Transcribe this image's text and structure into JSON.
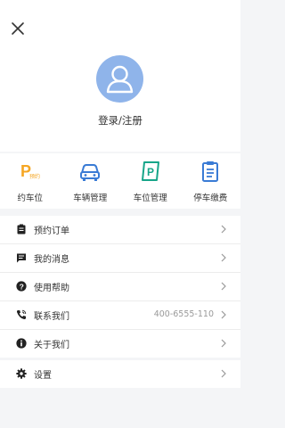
{
  "header": {
    "login_text": "登录/注册"
  },
  "quick_actions": [
    {
      "label": "约车位",
      "icon": "parking-reserve-icon",
      "color": "#f5a623"
    },
    {
      "label": "车辆管理",
      "icon": "car-icon",
      "color": "#3a7bd5"
    },
    {
      "label": "车位管理",
      "icon": "parking-space-icon",
      "color": "#17a589"
    },
    {
      "label": "停车缴费",
      "icon": "clipboard-icon",
      "color": "#3a7bd5"
    }
  ],
  "quick_badge": "预约",
  "quick_letter": "P",
  "menu": [
    {
      "label": "预约订单",
      "icon": "clipboard-icon"
    },
    {
      "label": "我的消息",
      "icon": "message-icon"
    },
    {
      "label": "使用帮助",
      "icon": "help-icon"
    },
    {
      "label": "联系我们",
      "icon": "phone-icon",
      "value": "400-6555-110"
    },
    {
      "label": "关于我们",
      "icon": "info-icon"
    }
  ],
  "settings": {
    "label": "设置",
    "icon": "gear-icon"
  }
}
